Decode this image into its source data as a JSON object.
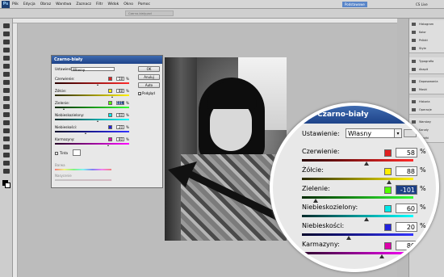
{
  "menubar": {
    "items": [
      "Plik",
      "Edycja",
      "Obraz",
      "Warstwa",
      "Zaznacz",
      "Filtr",
      "Widok",
      "Okno",
      "Pomoc"
    ],
    "workspace": "Podstawowe",
    "cs_live": "CS Live"
  },
  "document": {
    "tab": "Czarno-biały.psd"
  },
  "panels": [
    {
      "label": "Histogram"
    },
    {
      "label": "Kolor"
    },
    {
      "label": "Próbki"
    },
    {
      "label": "Style"
    },
    {
      "label": "Typografia"
    },
    {
      "label": "Akapit"
    },
    {
      "label": "Dopasowania"
    },
    {
      "label": "Maski"
    },
    {
      "label": "Historia"
    },
    {
      "label": "Operacje"
    },
    {
      "label": "Warstwy"
    },
    {
      "label": "Kanały"
    },
    {
      "label": "Ścieżki"
    }
  ],
  "dialog": {
    "title": "Czarno-biały",
    "preset_label": "Ustawienie:",
    "preset_value": "Własny",
    "buttons": {
      "ok": "OK",
      "cancel": "Anuluj",
      "auto": "Auto"
    },
    "preview": "Podgląd",
    "tint": "Tinta",
    "hue": "Barwa",
    "saturation": "Nasycenie"
  },
  "sliders": [
    {
      "label": "Czerwienie:",
      "value": "58",
      "swatch": "#e02020",
      "pos": 0.58,
      "grad": [
        "#2a0000",
        "#ff2a2a"
      ]
    },
    {
      "label": "Żółcie:",
      "value": "88",
      "swatch": "#ffee00",
      "pos": 0.78,
      "grad": [
        "#2a2a00",
        "#fff000"
      ]
    },
    {
      "label": "Zielenie:",
      "value": "-101",
      "swatch": "#55ff00",
      "pos": 0.12,
      "selected": true,
      "grad": [
        "#002a00",
        "#33ff33"
      ]
    },
    {
      "label": "Niebieskozielony:",
      "value": "60",
      "swatch": "#00e8e8",
      "pos": 0.58,
      "grad": [
        "#002a2a",
        "#00ffff"
      ]
    },
    {
      "label": "Niebieskości:",
      "value": "20",
      "swatch": "#2222dd",
      "pos": 0.42,
      "grad": [
        "#00002a",
        "#3333ff"
      ]
    },
    {
      "label": "Karmazyny:",
      "value": "80",
      "swatch": "#dd00aa",
      "pos": 0.72,
      "grad": [
        "#2a002a",
        "#ff00ff"
      ]
    }
  ],
  "magnifier": {
    "title": "Czarno-biały",
    "preset_label": "Ustawienie:",
    "preset_value": "Własny"
  },
  "percent": "%"
}
